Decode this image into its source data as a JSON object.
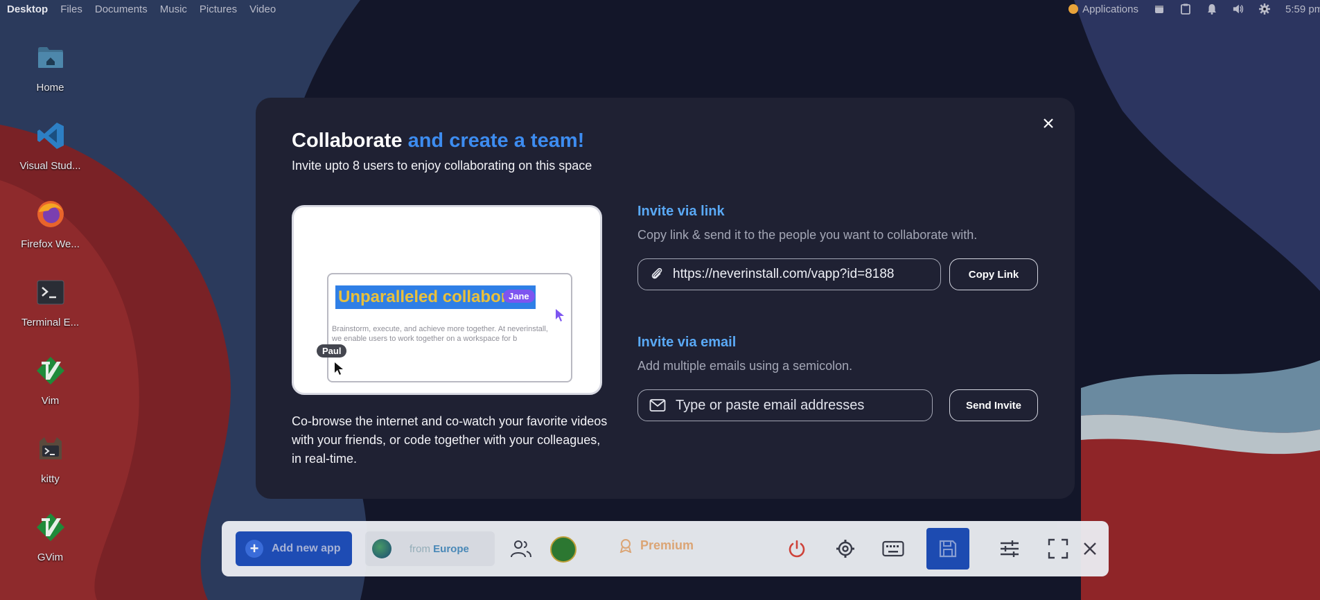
{
  "topbar": {
    "menu": [
      "Desktop",
      "Files",
      "Documents",
      "Music",
      "Pictures",
      "Video"
    ],
    "applications_label": "Applications",
    "clock": "5:59 pm"
  },
  "desktop_icons": [
    {
      "label": "Home",
      "icon": "home-folder-icon"
    },
    {
      "label": "Visual Stud...",
      "icon": "vscode-icon"
    },
    {
      "label": "Firefox We...",
      "icon": "firefox-icon"
    },
    {
      "label": "Terminal E...",
      "icon": "terminal-icon"
    },
    {
      "label": "Vim",
      "icon": "vim-icon"
    },
    {
      "label": "kitty",
      "icon": "kitty-icon"
    },
    {
      "label": "GVim",
      "icon": "gvim-icon"
    }
  ],
  "modal": {
    "title_main": "Collaborate",
    "title_accent": "and create a team!",
    "subtitle": "Invite upto 8 users to enjoy collaborating on this space",
    "preview": {
      "headline": "Unparalleled collaborat",
      "body": "Brainstorm, execute, and achieve more together. At neverinstall, we enable users to work together on a workspace for b",
      "user1": "Jane",
      "user2": "Paul"
    },
    "description": "Co-browse the internet and co-watch your favorite videos with your friends, or code together with your colleagues, in real-time.",
    "link_section": {
      "title": "Invite via link",
      "subtitle": "Copy link & send it to the people you want to collaborate with.",
      "url": "https://neverinstall.com/vapp?id=8188",
      "button": "Copy Link"
    },
    "email_section": {
      "title": "Invite via email",
      "subtitle": "Add multiple emails using a semicolon.",
      "placeholder": "Type or paste email addresses",
      "button": "Send Invite"
    }
  },
  "dock": {
    "add_app": "Add new app",
    "region_prefix": "from",
    "region": "Europe",
    "premium": "Premium"
  },
  "colors": {
    "accent_blue": "#3d8cf0",
    "section_blue": "#5aa9f5",
    "modal_bg": "#1f2133",
    "dock_blue": "#1e4eb9",
    "power_red": "#d9453a",
    "premium": "#e6ad7a"
  }
}
